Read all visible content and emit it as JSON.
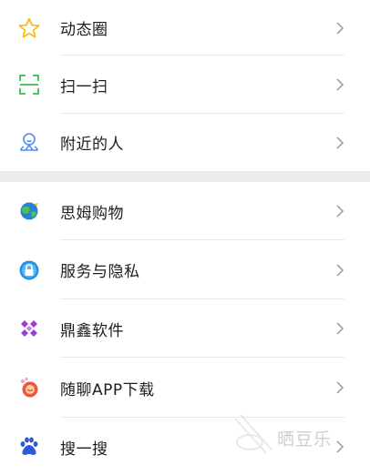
{
  "group1": {
    "items": [
      {
        "label": "动态圈",
        "icon": "star-icon"
      },
      {
        "label": "扫一扫",
        "icon": "scan-icon"
      },
      {
        "label": "附近的人",
        "icon": "nearby-person-icon"
      }
    ]
  },
  "group2": {
    "items": [
      {
        "label": "思姆购物",
        "icon": "globe-shopping-icon"
      },
      {
        "label": "服务与隐私",
        "icon": "lock-icon"
      },
      {
        "label": "鼎鑫软件",
        "icon": "diamond-cluster-icon"
      },
      {
        "label": "随聊APP下载",
        "icon": "chat-app-icon"
      },
      {
        "label": "搜一搜",
        "icon": "baidu-paw-icon"
      }
    ]
  },
  "watermark": {
    "text": "晒豆乐"
  },
  "colors": {
    "accent_green": "#2fbf4a",
    "star_yellow": "#f5b800",
    "person_blue": "#4a8df0",
    "separator": "#ececec"
  }
}
